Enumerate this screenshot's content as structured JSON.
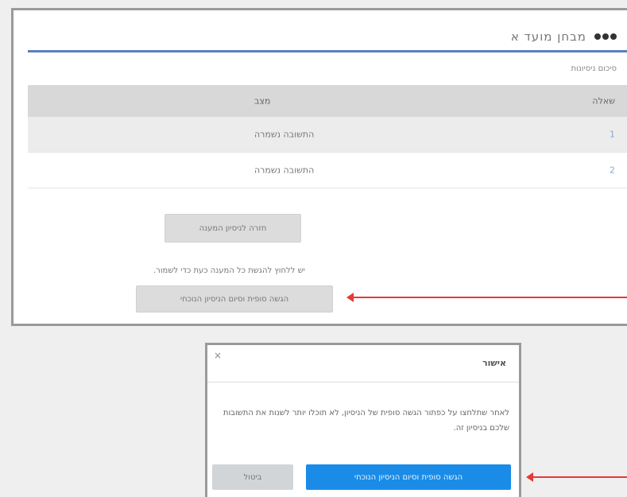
{
  "panel": {
    "title": "מבחן מועד א",
    "subtitle": "סיכום ניסיונות",
    "table": {
      "headers": {
        "number": "שאלה",
        "status": "מצב"
      },
      "rows": [
        {
          "number": "1",
          "status": "התשובה נשמרה"
        },
        {
          "number": "2",
          "status": "התשובה נשמרה"
        }
      ]
    },
    "return_button": "חזרה לניסיון המענה",
    "note": "יש ללחוץ להגשת כל המענה כעת כדי לשמור.",
    "submit_button": "הגשה סופית וסיום הניסיון הנוכחי"
  },
  "dialog": {
    "close": "×",
    "title": "אישור",
    "body": "לאחר שתלחצו על כפתור הגשה סופית של הניסיון, לא תוכלו יותר לשנות את התשובות שלכם בניסיון זה.",
    "confirm_button": "הגשה סופית וסיום הניסיון הנוכחי",
    "cancel_button": "ביטול"
  },
  "colors": {
    "accent": "#5a7fc2",
    "primary": "#1a8ce8",
    "arrow": "#e53935"
  }
}
